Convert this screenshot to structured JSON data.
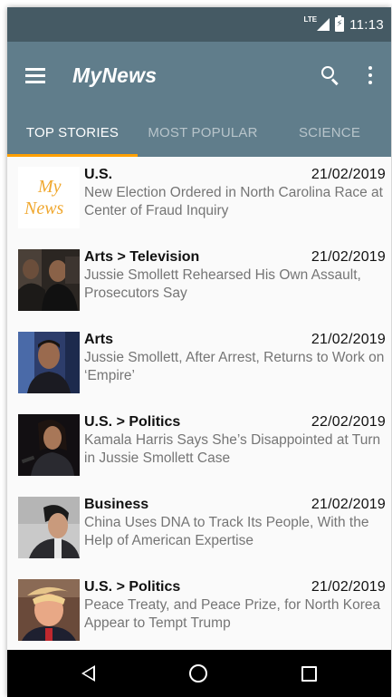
{
  "status_bar": {
    "network": "LTE",
    "time": "11:13"
  },
  "toolbar": {
    "title": "MyNews",
    "menu_icon": "hamburger-icon",
    "search_icon": "search-icon",
    "more_icon": "more-vert-icon"
  },
  "tabs": [
    {
      "label": "Top Stories",
      "active": true
    },
    {
      "label": "Most Popular",
      "active": false
    },
    {
      "label": "Science",
      "active": false
    }
  ],
  "colors": {
    "status_bar": "#455a64",
    "toolbar": "#607d8b",
    "tab_indicator": "#ffa000",
    "logo_text": "#f0a830"
  },
  "articles": [
    {
      "section": "U.S.",
      "date": "21/02/2019",
      "headline": "New Election Ordered in North Carolina Race at Center of Fraud Inquiry",
      "thumbnail": "mynews-logo",
      "logo_line1": "My",
      "logo_line2": "News"
    },
    {
      "section": "Arts > Television",
      "date": "21/02/2019",
      "headline": "Jussie Smollett Rehearsed His Own Assault, Prosecutors Say",
      "thumbnail": "photo"
    },
    {
      "section": "Arts",
      "date": "21/02/2019",
      "headline": "Jussie Smollett, After Arrest, Returns to Work on ‘Empire’",
      "thumbnail": "photo"
    },
    {
      "section": "U.S. > Politics",
      "date": "22/02/2019",
      "headline": "Kamala Harris Says She’s Disappointed at Turn in Jussie Smollett Case",
      "thumbnail": "photo"
    },
    {
      "section": "Business",
      "date": "21/02/2019",
      "headline": "China Uses DNA to Track Its People, With the Help of American Expertise",
      "thumbnail": "photo"
    },
    {
      "section": "U.S. > Politics",
      "date": "21/02/2019",
      "headline": "Peace Treaty, and Peace Prize, for North Korea Appear to Tempt Trump",
      "thumbnail": "photo"
    }
  ],
  "nav_bar": {
    "back_icon": "back-icon",
    "home_icon": "home-icon",
    "recents_icon": "recents-icon"
  }
}
